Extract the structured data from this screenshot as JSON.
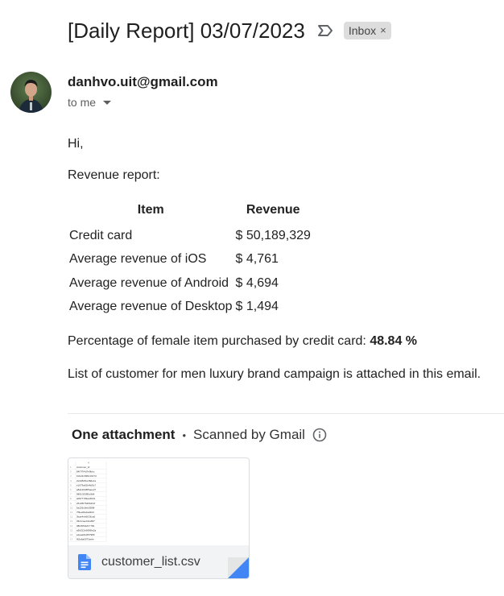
{
  "email": {
    "subject": "[Daily Report] 03/07/2023",
    "label": "Inbox",
    "label_close": "×",
    "sender": "danhvo.uit@gmail.com",
    "to": "to me",
    "greeting": "Hi,",
    "intro": "Revenue report:",
    "table": {
      "headers": [
        "Item",
        "Revenue"
      ],
      "rows": [
        [
          "Credit card",
          "$ 50,189,329"
        ],
        [
          "Average revenue of iOS",
          "$ 4,761"
        ],
        [
          "Average revenue of Android",
          "$ 4,694"
        ],
        [
          "Average revenue of Desktop",
          "$ 1,494"
        ]
      ]
    },
    "percentage_label": "Percentage of female item purchased by credit card: ",
    "percentage_value": "48.84 %",
    "closing": "List of customer for men luxury brand campaign is attached in this email."
  },
  "attachments": {
    "count_label": "One attachment",
    "separator": "•",
    "scanned_label": "Scanned by Gmail",
    "file_name": "customer_list.csv",
    "preview": {
      "column_label": "A",
      "header": "customer_id",
      "rows": [
        "84f7f7f4d7e9bbc",
        "1bb22c938c1b27d",
        "2e028df1e38de1a",
        "e1679a62b4b0fc7",
        "a8a12bb8f5aee27",
        "9801f1f2f86c9b8",
        "a0977709ee5b61",
        "26136f7646b23cf",
        "5a226c0eb0388f",
        "7f9ee6fe2ad4dd",
        "3bae4eb6f23fca0",
        "39c1cae24ca837",
        "08fc6f53ef1779b",
        "a5b522e5896fa2a",
        "edeaa01df67989",
        "f62a6a0073eefe"
      ]
    }
  },
  "icons": {
    "important": "important-marker-icon",
    "info": "info-icon",
    "file": "google-sheets-file-icon"
  },
  "colors": {
    "accent_blue": "#4285f4",
    "chip_bg": "#dddddd",
    "text": "#222222"
  }
}
